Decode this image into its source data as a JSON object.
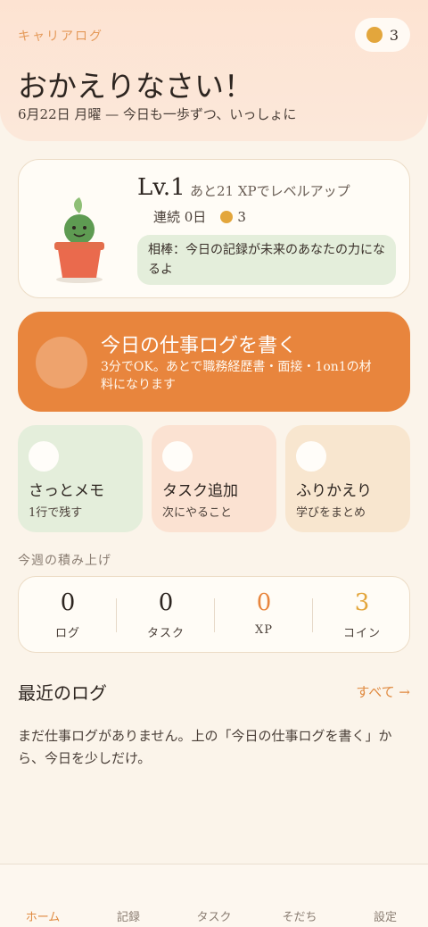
{
  "header": {
    "app_name": "キャリアログ",
    "coin_count": "3",
    "greeting": "おかえりなさい！",
    "subline": "6月22日 月曜 — 今日も一歩ずつ、いっしょに"
  },
  "level_card": {
    "level": "Lv.1",
    "next_level": "あと21 XPでレベルアップ",
    "streak": "連続 0日",
    "coins": "3",
    "partner_message": "相棒：今日の記録が未来のあなたの力になるよ"
  },
  "cta": {
    "title": "今日の仕事ログを書く",
    "subtitle": "3分でOK。あとで職務経歴書・面接・1on1の材料になります"
  },
  "quick_actions": [
    {
      "title": "さっとメモ",
      "subtitle": "1行で残す"
    },
    {
      "title": "タスク追加",
      "subtitle": "次にやること"
    },
    {
      "title": "ふりかえり",
      "subtitle": "学びをまとめ"
    }
  ],
  "weekly": {
    "label": "今週の積み上げ",
    "stats": [
      {
        "value": "0",
        "label": "ログ",
        "color": "#2d2520"
      },
      {
        "value": "0",
        "label": "タスク",
        "color": "#2d2520"
      },
      {
        "value": "0",
        "label": "XP",
        "color": "#e8853d"
      },
      {
        "value": "3",
        "label": "コイン",
        "color": "#e3a63c"
      }
    ]
  },
  "recent": {
    "title": "最近のログ",
    "see_all": "すべて →",
    "empty_message": "まだ仕事ログがありません。上の「今日の仕事ログを書く」から、今日を少しだけ。"
  },
  "tabs": [
    {
      "label": "ホーム",
      "active": true
    },
    {
      "label": "記録",
      "active": false
    },
    {
      "label": "タスク",
      "active": false
    },
    {
      "label": "そだち",
      "active": false
    },
    {
      "label": "設定",
      "active": false
    }
  ],
  "colors": {
    "accent": "#e8853d",
    "coin": "#e3a63c",
    "background": "#fbf4ea"
  },
  "icons": {
    "coin": "coin-icon",
    "mascot": "plant-mascot-icon"
  }
}
